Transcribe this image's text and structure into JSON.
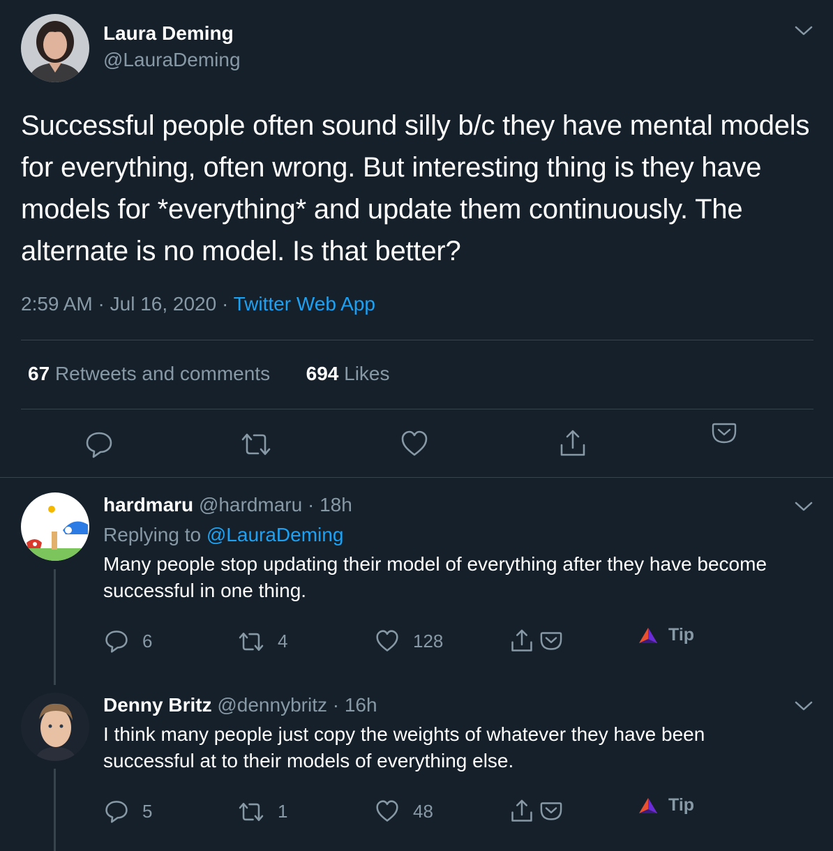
{
  "main_tweet": {
    "name": "Laura Deming",
    "handle": "@LauraDeming",
    "text": "Successful people often sound silly b/c they have mental models for everything, often wrong. But interesting thing is they have models for *everything* and update them continuously. The alternate is no model. Is that better?",
    "time": "2:59 AM",
    "date": "Jul 16, 2020",
    "source": "Twitter Web App",
    "retweets_count": "67",
    "retweets_label": "Retweets and comments",
    "likes_count": "694",
    "likes_label": "Likes"
  },
  "replies": [
    {
      "name": "hardmaru",
      "handle": "@hardmaru",
      "age": "18h",
      "replying_prefix": "Replying to",
      "replying_to": "@LauraDeming",
      "text": "Many people stop updating their model of everything after they have become successful in one thing.",
      "comments": "6",
      "retweets": "4",
      "likes": "128",
      "tip_label": "Tip"
    },
    {
      "name": "Denny Britz",
      "handle": "@dennybritz",
      "age": "16h",
      "text": "I think many people just copy the weights of whatever they have been successful at to their models of everything else.",
      "comments": "5",
      "retweets": "1",
      "likes": "48",
      "tip_label": "Tip"
    }
  ],
  "separator": "·",
  "icons": [
    "chevron-down-icon",
    "comment-icon",
    "retweet-icon",
    "heart-icon",
    "share-icon",
    "pocket-icon",
    "tip-triangle-icon"
  ],
  "colors": {
    "background": "#15202b",
    "text": "#ffffff",
    "muted": "#8899a6",
    "link": "#1da1f2",
    "divider": "#38444d"
  }
}
